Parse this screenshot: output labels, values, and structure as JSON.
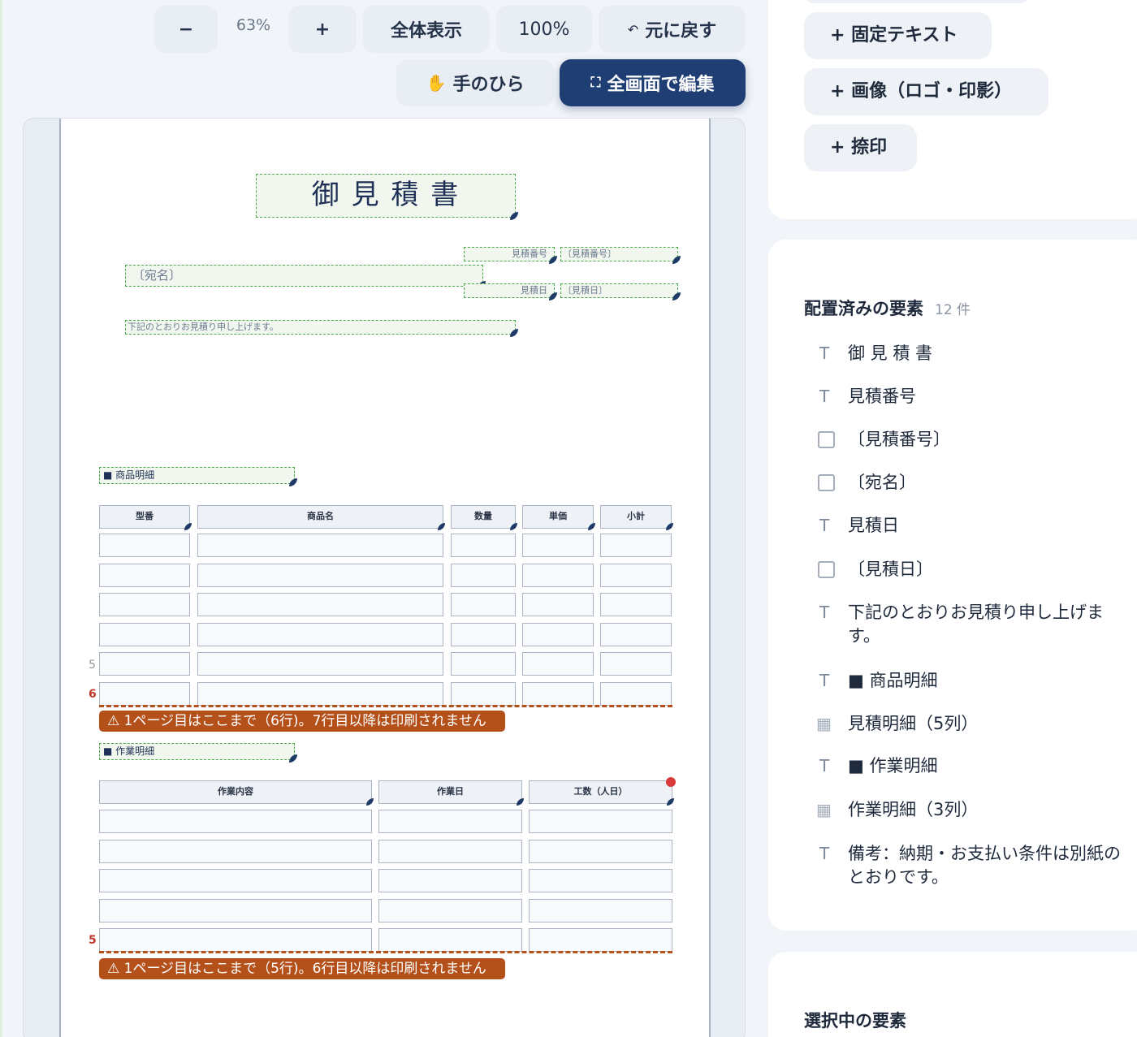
{
  "toolbar": {
    "zoom_out": "−",
    "zoom_value": "63%",
    "zoom_in": "+",
    "fit": "全体表示",
    "actual": "100%",
    "undo_icon": "↶",
    "undo": "元に戻す",
    "hand_icon": "✋",
    "hand": "手のひら",
    "fullscreen_icon": "⛶",
    "fullscreen": "全画面で編集"
  },
  "document": {
    "title": "御 見 積 書",
    "estimate_no_label": "見積番号",
    "estimate_no_value": "〔見積番号〕",
    "addressee": "〔宛名〕",
    "date_label": "見積日",
    "date_value": "〔見積日〕",
    "greeting": "下記のとおりお見積り申し上げます。",
    "section1": "■ 商品明細",
    "table1_headers": [
      "型番",
      "商品名",
      "数量",
      "単価",
      "小計"
    ],
    "table1_row5": "5",
    "table1_row6": "6",
    "table1_warning": "⚠ 1ページ目はここまで（6行)。7行目以降は印刷されません",
    "section2": "■ 作業明細",
    "table2_headers": [
      "作業内容",
      "作業日",
      "工数（人日）"
    ],
    "table2_row5": "5",
    "table2_warning": "⚠ 1ページ目はここまで（5行)。6行目以降は印刷されません"
  },
  "add_panel": {
    "fixed_text": "+ 固定テキスト",
    "image": "+ 画像（ロゴ・印影）",
    "stamp": "+ 捺印"
  },
  "placed": {
    "title": "配置済みの要素",
    "count": "12 件",
    "items": [
      {
        "icon": "T",
        "label": "御 見 積 書"
      },
      {
        "icon": "T",
        "label": "見積番号"
      },
      {
        "icon": "box",
        "label": "〔見積番号〕"
      },
      {
        "icon": "box",
        "label": "〔宛名〕"
      },
      {
        "icon": "T",
        "label": "見積日"
      },
      {
        "icon": "box",
        "label": "〔見積日〕"
      },
      {
        "icon": "T",
        "label": "下記のとおりお見積り申し上げます。"
      },
      {
        "icon": "T",
        "label": "■ 商品明細"
      },
      {
        "icon": "grid",
        "label": "見積明細（5列）"
      },
      {
        "icon": "T",
        "label": "■ 作業明細"
      },
      {
        "icon": "grid",
        "label": "作業明細（3列）"
      },
      {
        "icon": "T",
        "label": "備考：納期・お支払い条件は別紙のとおりです。"
      }
    ]
  },
  "selected": {
    "title": "選択中の要素"
  }
}
